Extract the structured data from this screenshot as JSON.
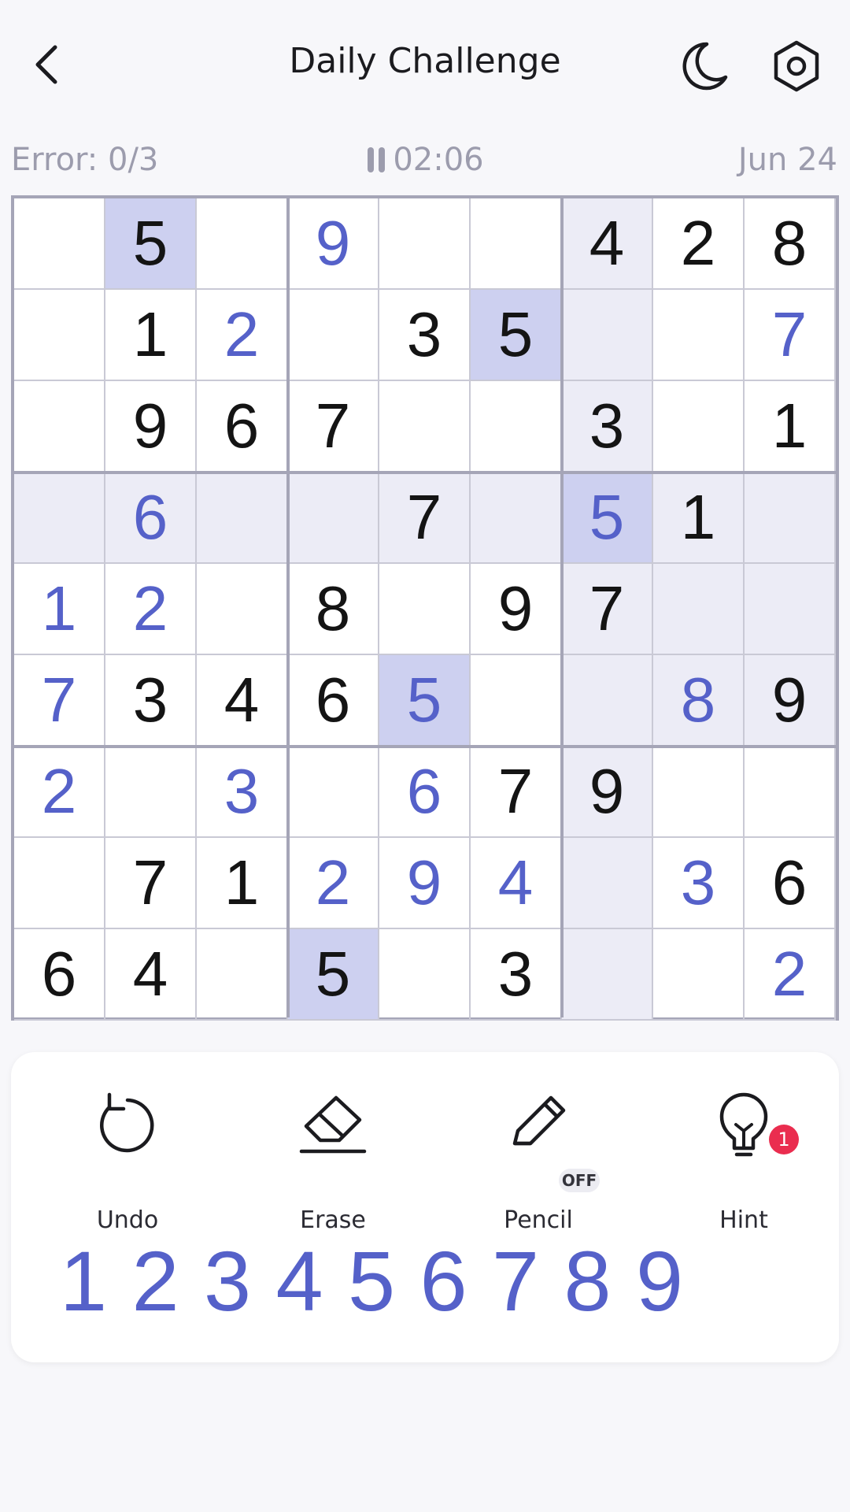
{
  "header": {
    "title": "Daily Challenge",
    "back_icon": "chevron-left-icon",
    "theme_icon": "moon-icon",
    "settings_icon": "gear-icon"
  },
  "status": {
    "errors": "Error: 0/3",
    "timer": "02:06",
    "date": "Jun 24"
  },
  "colors": {
    "accent": "#5561c9",
    "given": "#141414",
    "highlight_band": "#ececf6",
    "highlight_same": "#cdd0f0",
    "badge": "#ea2d4f"
  },
  "board": {
    "rows": [
      [
        "",
        "5",
        "",
        "9",
        "",
        "",
        "4",
        "2",
        "8"
      ],
      [
        "",
        "1",
        "2",
        "",
        "3",
        "5",
        "",
        "",
        "7"
      ],
      [
        "",
        "9",
        "6",
        "7",
        "",
        "",
        "3",
        "",
        "1"
      ],
      [
        "",
        "6",
        "",
        "",
        "7",
        "",
        "5",
        "1",
        ""
      ],
      [
        "1",
        "2",
        "",
        "8",
        "",
        "9",
        "7",
        "",
        ""
      ],
      [
        "7",
        "3",
        "4",
        "6",
        "5",
        "",
        "",
        "8",
        "9"
      ],
      [
        "2",
        "",
        "3",
        "",
        "6",
        "7",
        "9",
        "",
        ""
      ],
      [
        "",
        "7",
        "1",
        "2",
        "9",
        "4",
        "",
        "3",
        "6"
      ],
      [
        "6",
        "4",
        "",
        "5",
        "",
        "3",
        "",
        "",
        "2"
      ]
    ],
    "entry_types": [
      [
        "",
        "g",
        "",
        "u",
        "",
        "",
        "g",
        "g",
        "g"
      ],
      [
        "",
        "g",
        "u",
        "",
        "g",
        "g",
        "",
        "",
        "u"
      ],
      [
        "",
        "g",
        "g",
        "g",
        "",
        "",
        "g",
        "",
        "g"
      ],
      [
        "",
        "u",
        "",
        "",
        "g",
        "",
        "u",
        "g",
        ""
      ],
      [
        "u",
        "u",
        "",
        "g",
        "",
        "g",
        "g",
        "",
        ""
      ],
      [
        "u",
        "g",
        "g",
        "g",
        "u",
        "",
        "",
        "u",
        "g"
      ],
      [
        "u",
        "",
        "u",
        "",
        "u",
        "g",
        "g",
        "",
        ""
      ],
      [
        "",
        "g",
        "g",
        "u",
        "u",
        "u",
        "",
        "u",
        "g"
      ],
      [
        "g",
        "g",
        "",
        "g",
        "",
        "g",
        "",
        "",
        "u"
      ]
    ],
    "selected": {
      "row": 3,
      "col": 6
    },
    "highlighted_value": "5"
  },
  "tools": [
    {
      "label": "Undo",
      "icon": "undo-icon"
    },
    {
      "label": "Erase",
      "icon": "eraser-icon"
    },
    {
      "label": "Pencil",
      "icon": "pencil-icon",
      "state": "OFF"
    },
    {
      "label": "Hint",
      "icon": "lightbulb-icon",
      "badge": "1"
    }
  ],
  "numbers": [
    "1",
    "2",
    "3",
    "4",
    "5",
    "6",
    "7",
    "8",
    "9"
  ]
}
